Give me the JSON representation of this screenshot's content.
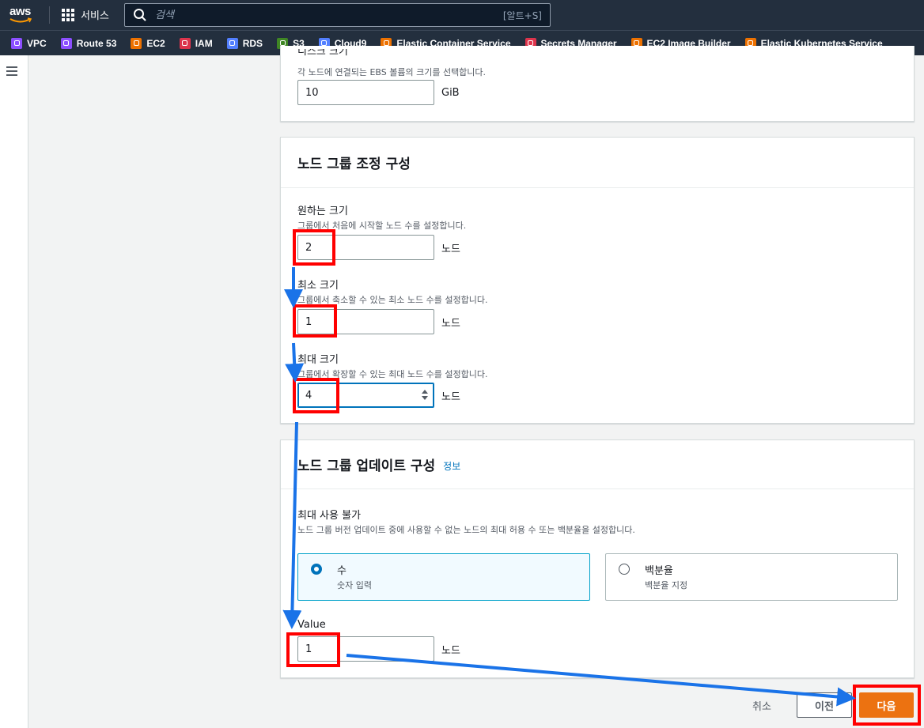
{
  "topnav": {
    "logo_text": "aws",
    "services_label": "서비스",
    "search_placeholder": "검색",
    "search_shortcut": "[알트+S]"
  },
  "favorites": [
    {
      "label": "VPC",
      "icon": "vpc-icon",
      "color": "#8c4fff"
    },
    {
      "label": "Route 53",
      "icon": "route53-icon",
      "color": "#8c4fff"
    },
    {
      "label": "EC2",
      "icon": "ec2-icon",
      "color": "#ed7100"
    },
    {
      "label": "IAM",
      "icon": "iam-icon",
      "color": "#dd344c"
    },
    {
      "label": "RDS",
      "icon": "rds-icon",
      "color": "#527fff"
    },
    {
      "label": "S3",
      "icon": "s3-icon",
      "color": "#3f8624"
    },
    {
      "label": "Cloud9",
      "icon": "cloud9-icon",
      "color": "#527fff"
    },
    {
      "label": "Elastic Container Service",
      "icon": "ecs-icon",
      "color": "#ed7100"
    },
    {
      "label": "Secrets Manager",
      "icon": "secrets-manager-icon",
      "color": "#dd344c"
    },
    {
      "label": "EC2 Image Builder",
      "icon": "image-builder-icon",
      "color": "#ed7100"
    },
    {
      "label": "Elastic Kubernetes Service",
      "icon": "eks-icon",
      "color": "#ed7100"
    }
  ],
  "disk": {
    "cut_label": "디스크 크기",
    "description": "각 노드에 연결되는 EBS 볼륨의 크기를 선택합니다.",
    "value": "10",
    "unit": "GiB"
  },
  "scaling": {
    "title": "노드 그룹 조정 구성",
    "desired": {
      "label": "원하는 크기",
      "description": "그룹에서 처음에 시작할 노드 수를 설정합니다.",
      "value": "2",
      "unit": "노드"
    },
    "minimum": {
      "label": "최소 크기",
      "description": "그룹에서 축소할 수 있는 최소 노드 수를 설정합니다.",
      "value": "1",
      "unit": "노드"
    },
    "maximum": {
      "label": "최대 크기",
      "description": "그룹에서 확장할 수 있는 최대 노드 수를 설정합니다.",
      "value": "4",
      "unit": "노드"
    }
  },
  "update": {
    "title": "노드 그룹 업데이트 구성",
    "info_link": "정보",
    "max_unavailable": {
      "label": "최대 사용 불가",
      "description": "노드 그룹 버전 업데이트 중에 사용할 수 없는 노드의 최대 허용 수 또는 백분율을 설정합니다."
    },
    "options": [
      {
        "title": "수",
        "description": "숫자 입력",
        "selected": true
      },
      {
        "title": "백분율",
        "description": "백분율 지정",
        "selected": false
      }
    ],
    "value_label": "Value",
    "value": "1",
    "unit": "노드"
  },
  "actions": {
    "cancel": "취소",
    "previous": "이전",
    "next": "다음"
  },
  "colors": {
    "nav_bg": "#232f3e",
    "primary": "#ec7211",
    "link": "#0073bb",
    "annotation_box": "#ff0000",
    "annotation_arrow": "#1a73e8"
  }
}
